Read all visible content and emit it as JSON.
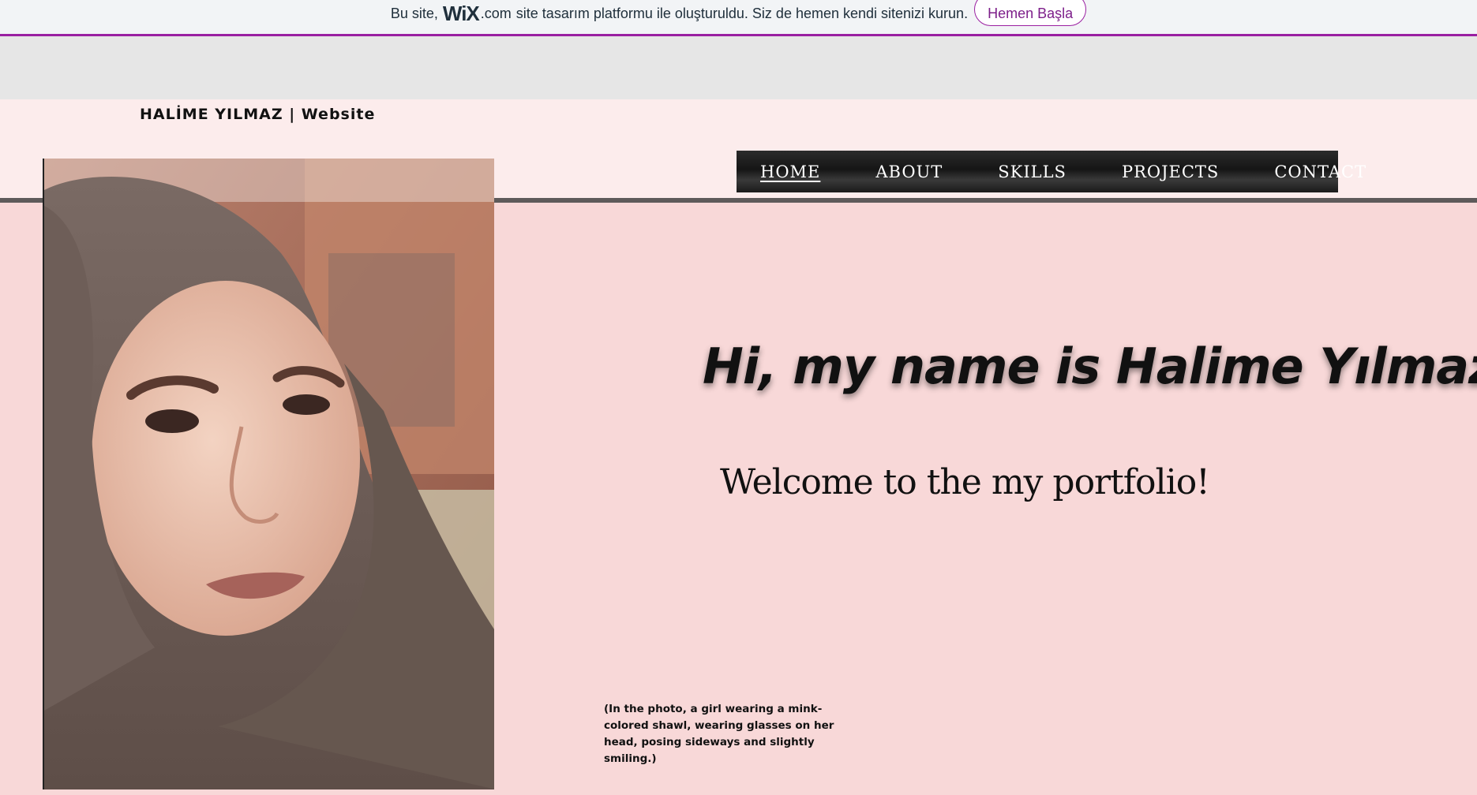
{
  "wix_banner": {
    "text_prefix": "Bu site,",
    "logo": "WiX",
    "dotcom": ".com",
    "text_suffix": "site tasarım platformu ile oluşturuldu. Siz de hemen kendi sitenizi kurun.",
    "cta_label": "Hemen Başla",
    "accent_color": "#9a1fa1"
  },
  "header": {
    "site_title": "HALİME YILMAZ | Website"
  },
  "nav": {
    "items": [
      {
        "label": "HOME",
        "active": true
      },
      {
        "label": "ABOUT",
        "active": false
      },
      {
        "label": "SKILLS",
        "active": false
      },
      {
        "label": "PROJECTS",
        "active": false
      },
      {
        "label": "CONTACT",
        "active": false
      }
    ]
  },
  "main": {
    "headline": "Hi, my name is Halime Yılmaz",
    "subheadline": "Welcome to the my portfolio!",
    "caption": "(In the photo, a girl wearing a mink-colored shawl, wearing glasses on her head, posing sideways and slightly smiling.)"
  },
  "colors": {
    "page_background": "#f8d8d8",
    "header_background": "#fcecec",
    "nav_background": "#1a1a1a"
  }
}
